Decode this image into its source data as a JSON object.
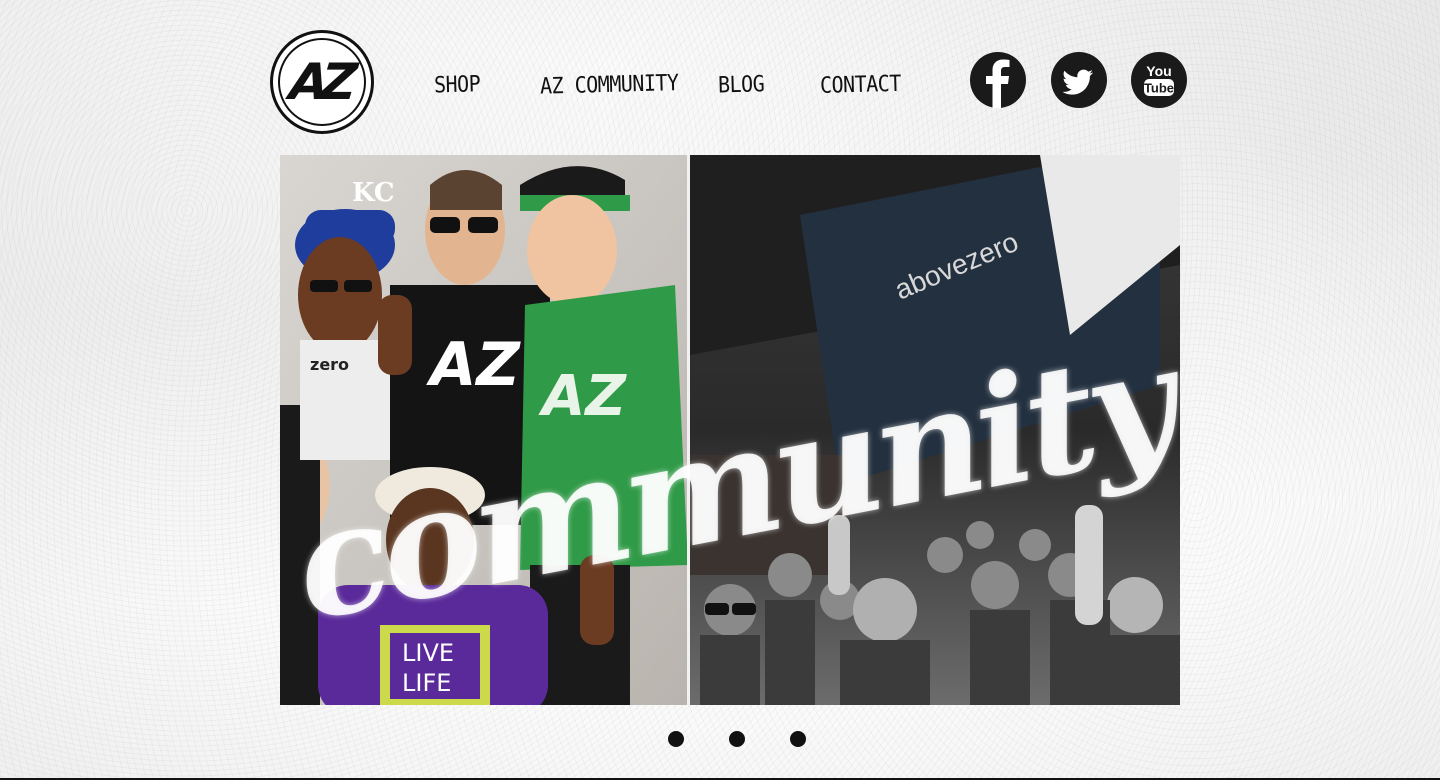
{
  "brand": {
    "logo_text": "AZ"
  },
  "nav": {
    "items": [
      {
        "label": "SHOP"
      },
      {
        "label": "AZ COMMUNITY"
      },
      {
        "label": "BLOG"
      },
      {
        "label": "CONTACT"
      }
    ]
  },
  "social": {
    "icons": [
      "facebook-icon",
      "twitter-icon",
      "youtube-icon"
    ],
    "youtube_label_top": "You",
    "youtube_label_bottom": "Tube"
  },
  "hero": {
    "overlay_word": "community",
    "sign_text": "abovezero",
    "shirt_text_live": "LIVE",
    "shirt_text_life": "LIFE",
    "cap_text": "KC",
    "shirt_text_zero": "zero"
  },
  "slider": {
    "slide_count": 3
  },
  "colors": {
    "ink": "#111111",
    "background": "#f4f4f4",
    "shirt_green": "#2f9a47",
    "shirt_purple": "#5a2a9a"
  }
}
